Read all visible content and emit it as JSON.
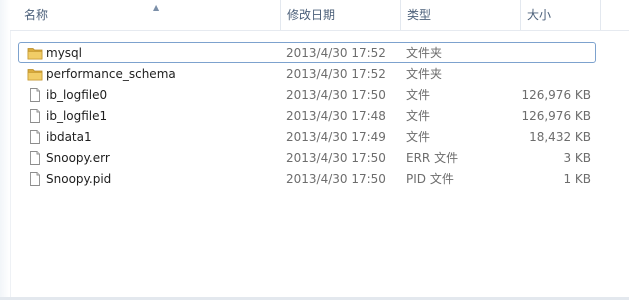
{
  "columns": {
    "name": "名称",
    "modified": "修改日期",
    "type": "类型",
    "size": "大小"
  },
  "files": [
    {
      "name": "mysql",
      "modified": "2013/4/30 17:52",
      "type": "文件夹",
      "size": "",
      "icon": "folder-icon"
    },
    {
      "name": "performance_schema",
      "modified": "2013/4/30 17:52",
      "type": "文件夹",
      "size": "",
      "icon": "folder-icon"
    },
    {
      "name": "ib_logfile0",
      "modified": "2013/4/30 17:50",
      "type": "文件",
      "size": "126,976 KB",
      "icon": "file-icon"
    },
    {
      "name": "ib_logfile1",
      "modified": "2013/4/30 17:48",
      "type": "文件",
      "size": "126,976 KB",
      "icon": "file-icon"
    },
    {
      "name": "ibdata1",
      "modified": "2013/4/30 17:49",
      "type": "文件",
      "size": "18,432 KB",
      "icon": "file-icon"
    },
    {
      "name": "Snoopy.err",
      "modified": "2013/4/30 17:50",
      "type": "ERR 文件",
      "size": "3 KB",
      "icon": "file-icon"
    },
    {
      "name": "Snoopy.pid",
      "modified": "2013/4/30 17:50",
      "type": "PID 文件",
      "size": "1 KB",
      "icon": "file-icon"
    }
  ],
  "colors": {
    "header_text": "#4c607a",
    "focus_border": "#7da2ce",
    "folder": "#e8c15a"
  }
}
